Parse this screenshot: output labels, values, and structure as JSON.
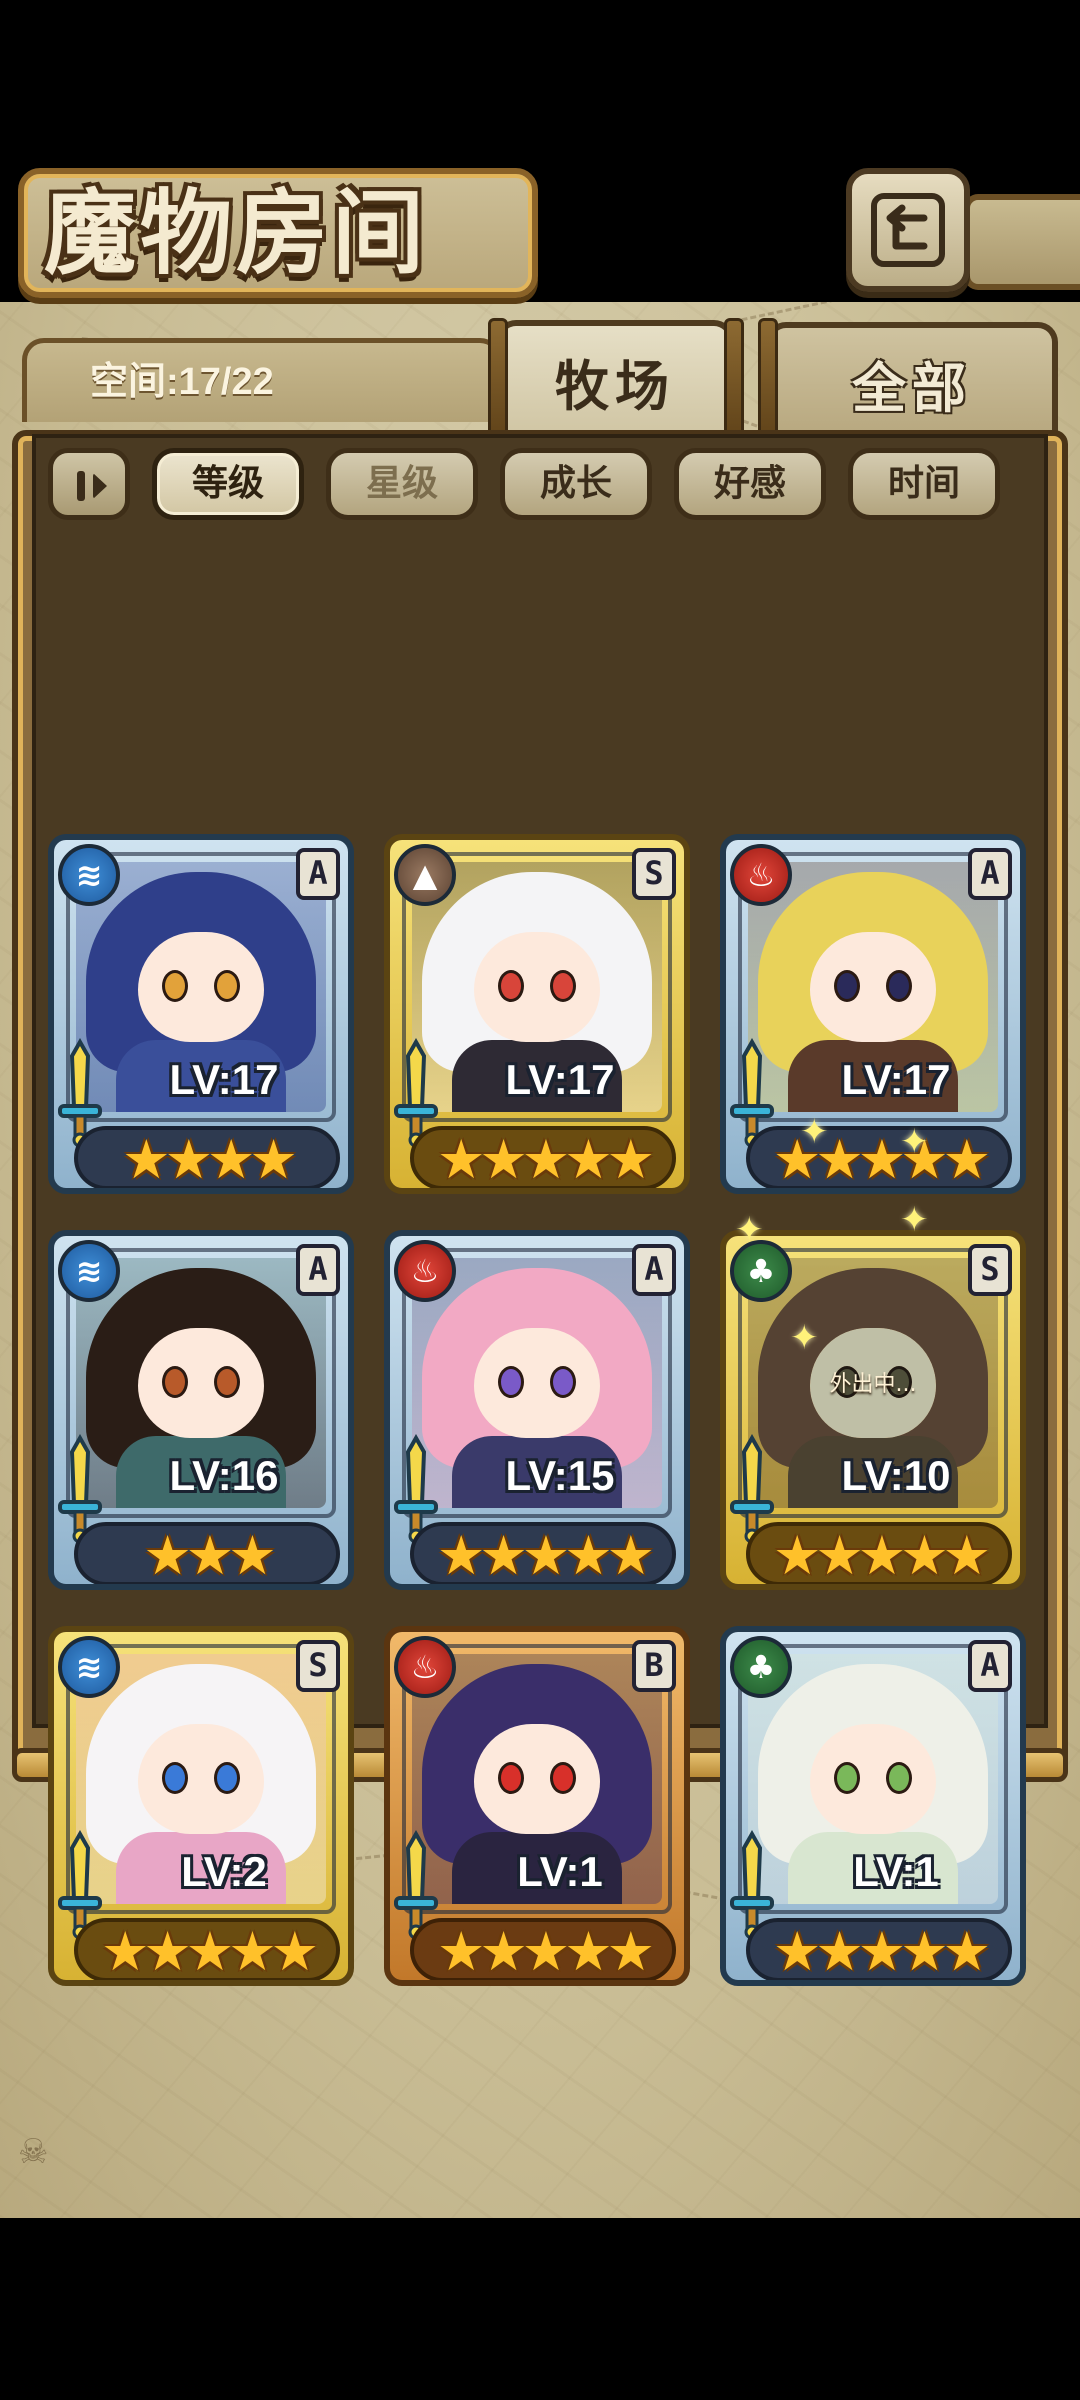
{
  "title": "魔物房间",
  "space": "空间:17/22",
  "tabs": {
    "ranch": "牧场",
    "all": "全部"
  },
  "sort": [
    "等级",
    "星级",
    "成长",
    "好感",
    "时间"
  ],
  "sort_active": 0,
  "cards": [
    {
      "element": "water-icon",
      "rank": "A",
      "level": "LV:17",
      "stars": "★★★★",
      "frame": "blue",
      "status": ""
    },
    {
      "element": "earth-icon",
      "rank": "S",
      "level": "LV:17",
      "stars": "★★★★★",
      "frame": "gold",
      "status": ""
    },
    {
      "element": "fire-icon",
      "rank": "A",
      "level": "LV:17",
      "stars": "★★★★★",
      "frame": "blue",
      "status": ""
    },
    {
      "element": "water-icon",
      "rank": "A",
      "level": "LV:16",
      "stars": "★★★",
      "frame": "blue",
      "status": ""
    },
    {
      "element": "fire-icon",
      "rank": "A",
      "level": "LV:15",
      "stars": "★★★★★",
      "frame": "blue",
      "status": ""
    },
    {
      "element": "wind-icon",
      "rank": "S",
      "level": "LV:10",
      "stars": "★★★★★",
      "frame": "gold",
      "status": "外出中..."
    },
    {
      "element": "water-icon",
      "rank": "S",
      "level": "LV:2",
      "stars": "★★★★★",
      "frame": "gold",
      "status": ""
    },
    {
      "element": "fire-icon",
      "rank": "B",
      "level": "LV:1",
      "stars": "★★★★★",
      "frame": "bronze",
      "status": ""
    },
    {
      "element": "wind-icon",
      "rank": "A",
      "level": "LV:1",
      "stars": "★★★★★",
      "frame": "blue",
      "status": ""
    }
  ],
  "colors": {
    "panel": "#8a6c3e",
    "gold_frame": "#f6e27a",
    "blue_frame": "#cfe3f0",
    "bronze_frame": "#f1b96a",
    "star": "#ffc12a"
  }
}
